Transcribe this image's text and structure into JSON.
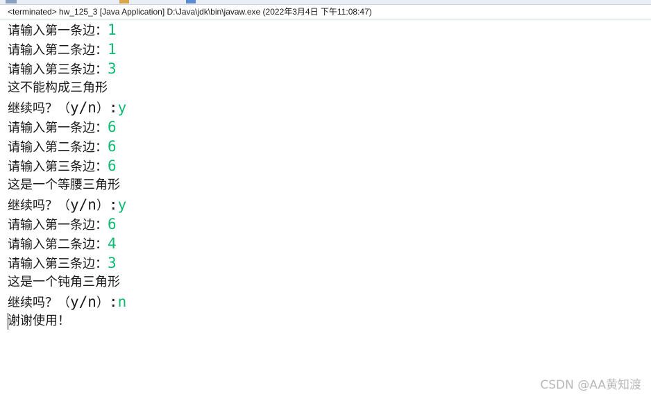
{
  "header": {
    "status": "<terminated> hw_125_3 [Java Application] D:\\Java\\jdk\\bin\\javaw.exe (2022年3月4日 下午11:08:47)"
  },
  "console": {
    "lines": [
      {
        "prompt": "请输入第一条边：",
        "input": "1"
      },
      {
        "prompt": "请输入第二条边：",
        "input": "1"
      },
      {
        "prompt": "请输入第三条边：",
        "input": "3"
      },
      {
        "text": "这不能构成三角形"
      },
      {
        "prompt": "继续吗？（",
        "ascii": "y/n",
        "prompt2": "）",
        "ascii2": ":",
        "input": "y"
      },
      {
        "prompt": "请输入第一条边：",
        "input": "6"
      },
      {
        "prompt": "请输入第二条边：",
        "input": "6"
      },
      {
        "prompt": "请输入第三条边：",
        "input": "6"
      },
      {
        "text": "这是一个等腰三角形"
      },
      {
        "prompt": "继续吗？（",
        "ascii": "y/n",
        "prompt2": "）",
        "ascii2": ":",
        "input": "y"
      },
      {
        "prompt": "请输入第一条边：",
        "input": "6"
      },
      {
        "prompt": "请输入第二条边：",
        "input": "4"
      },
      {
        "prompt": "请输入第三条边：",
        "input": "3"
      },
      {
        "text": "这是一个钝角三角形"
      },
      {
        "prompt": "继续吗？（",
        "ascii": "y/n",
        "prompt2": "）",
        "ascii2": ":",
        "input": "n"
      },
      {
        "text": "谢谢使用！"
      }
    ]
  },
  "watermark": "CSDN @AA黄知渡",
  "colors": {
    "input_text": "#0eba72",
    "output_text": "#1a1a1a",
    "background": "#ffffff"
  }
}
